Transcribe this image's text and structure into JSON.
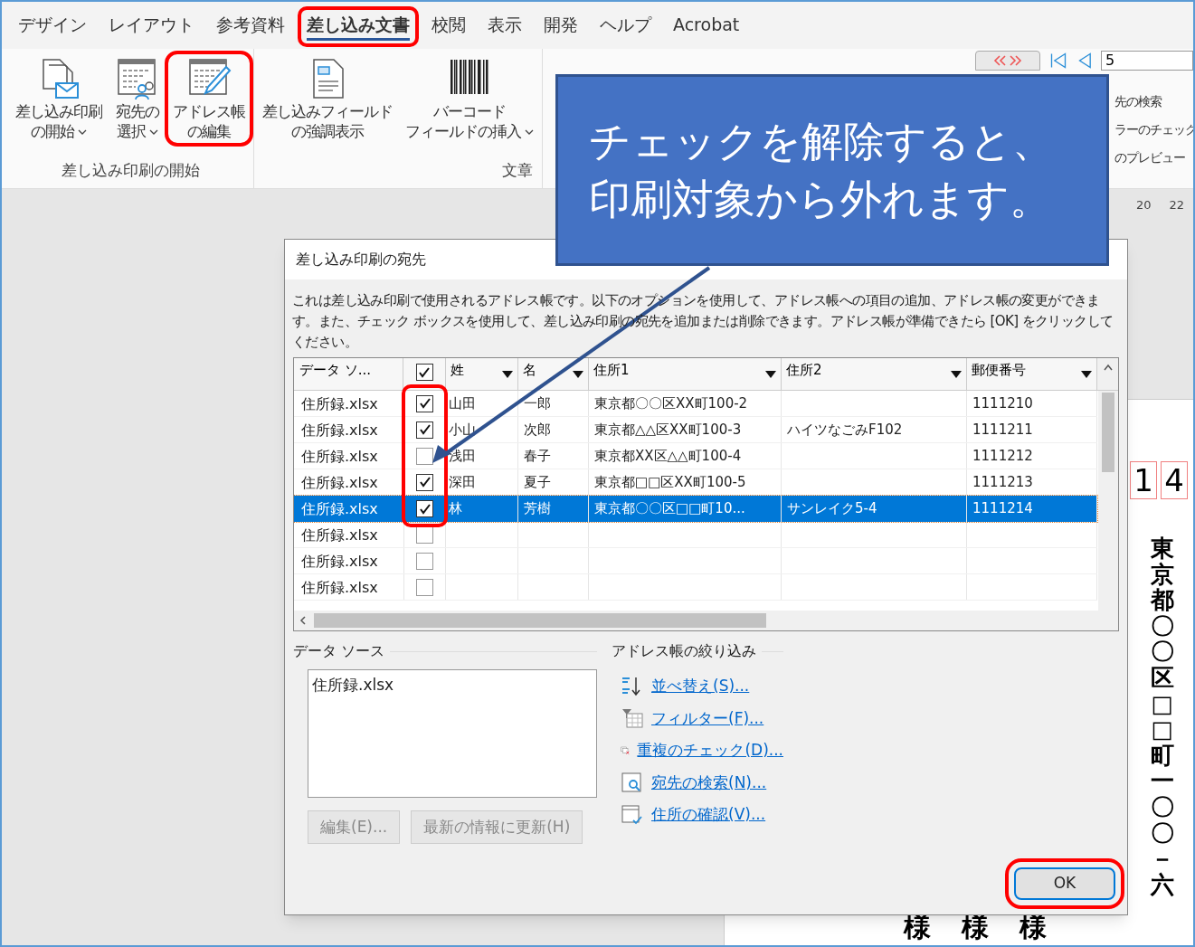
{
  "ribbon_tabs": [
    {
      "label": "デザイン",
      "selected": false,
      "highlighted": false
    },
    {
      "label": "レイアウト",
      "selected": false,
      "highlighted": false
    },
    {
      "label": "参考資料",
      "selected": false,
      "highlighted": false
    },
    {
      "label": "差し込み文書",
      "selected": true,
      "highlighted": true
    },
    {
      "label": "校閲",
      "selected": false,
      "highlighted": false
    },
    {
      "label": "表示",
      "selected": false,
      "highlighted": false
    },
    {
      "label": "開発",
      "selected": false,
      "highlighted": false
    },
    {
      "label": "ヘルプ",
      "selected": false,
      "highlighted": false
    },
    {
      "label": "Acrobat",
      "selected": false,
      "highlighted": false
    }
  ],
  "ribbon_groups": [
    {
      "label": "差し込み印刷の開始",
      "buttons": [
        {
          "kind": "start",
          "lines": [
            "差し込み印刷",
            "の開始"
          ],
          "dropdown": true,
          "highlighted": false
        },
        {
          "kind": "recipients",
          "lines": [
            "宛先の",
            "選択"
          ],
          "dropdown": true,
          "highlighted": false
        },
        {
          "kind": "edit",
          "lines": [
            "アドレス帳",
            "の編集"
          ],
          "dropdown": false,
          "highlighted": true
        }
      ]
    },
    {
      "label": "文章",
      "buttons": [
        {
          "kind": "field",
          "lines": [
            "差し込みフィールド",
            "の強調表示"
          ],
          "dropdown": false,
          "highlighted": false
        },
        {
          "kind": "barcode",
          "lines": [
            "バーコード",
            "フィールドの挿入"
          ],
          "dropdown": true,
          "highlighted": false
        }
      ]
    }
  ],
  "ribbon_preview": {
    "record_field": "5",
    "labels": [
      "先の検索",
      "ラーのチェック",
      "のプレビュー"
    ]
  },
  "ruler": [
    "20",
    "22"
  ],
  "callout": {
    "lines": [
      "チェックを解除すると、",
      "印刷対象から外れます。"
    ]
  },
  "dialog": {
    "title": "差し込み印刷の宛先",
    "description": "これは差し込み印刷で使用されるアドレス帳です。以下のオプションを使用して、アドレス帳への項目の追加、アドレス帳の変更ができます。また、チェック ボックスを使用して、差し込み印刷の宛先を追加または削除できます。アドレス帳が準備できたら [OK] をクリックしてください。",
    "table": {
      "columns": [
        "データ ソ...",
        "姓",
        "名",
        "住所1",
        "住所2",
        "郵便番号"
      ],
      "header_checked": true,
      "check_column_highlighted": true,
      "rows": [
        {
          "source": "住所録.xlsx",
          "checked": true,
          "selected": false,
          "surname": "山田",
          "given_name": "一郎",
          "address_1": "東京都〇〇区XX町100-2",
          "postal_code": "1111210"
        },
        {
          "source": "住所録.xlsx",
          "checked": true,
          "selected": false,
          "surname": "小山",
          "given_name": "次郎",
          "address_1": "東京都△△区XX町100-3",
          "address_2": "ハイツなごみF102",
          "postal_code": "1111211"
        },
        {
          "source": "住所録.xlsx",
          "checked": false,
          "selected": false,
          "surname": "浅田",
          "given_name": "春子",
          "address_1": "東京都XX区△△町100-4",
          "postal_code": "1111212"
        },
        {
          "source": "住所録.xlsx",
          "checked": true,
          "selected": false,
          "surname": "深田",
          "given_name": "夏子",
          "address_1": "東京都□□区XX町100-5",
          "postal_code": "1111213"
        },
        {
          "source": "住所録.xlsx",
          "checked": true,
          "selected": true,
          "surname": "林",
          "given_name": "芳樹",
          "address_1": "東京都〇〇区□□町10...",
          "address_2": "サンレイク5-4",
          "postal_code": "1111214"
        },
        {
          "source": "住所録.xlsx",
          "checked": false,
          "selected": false
        },
        {
          "source": "住所録.xlsx",
          "checked": false,
          "selected": false
        },
        {
          "source": "住所録.xlsx",
          "checked": false,
          "selected": false
        }
      ]
    },
    "data_source": {
      "label": "データ ソース",
      "items": [
        "住所録.xlsx"
      ],
      "buttons": [
        {
          "label": "編集(E)...",
          "disabled": true
        },
        {
          "label": "最新の情報に更新(H)",
          "disabled": true
        }
      ]
    },
    "refine": {
      "label": "アドレス帳の絞り込み",
      "links": [
        {
          "kind": "sort",
          "label": "並べ替え(S)..."
        },
        {
          "kind": "filter",
          "label": "フィルター(F)..."
        },
        {
          "kind": "duplicates",
          "label": "重複のチェック(D)..."
        },
        {
          "kind": "find",
          "label": "宛先の検索(N)..."
        },
        {
          "kind": "validate",
          "label": "住所の確認(V)..."
        }
      ]
    },
    "ok_button": {
      "label": "OK",
      "highlighted": true
    }
  },
  "document": {
    "postal_digits": [
      "1",
      "4"
    ],
    "address": "東京都〇〇区□□町一〇〇－六",
    "honorifics": [
      "様",
      "様",
      "様"
    ]
  }
}
